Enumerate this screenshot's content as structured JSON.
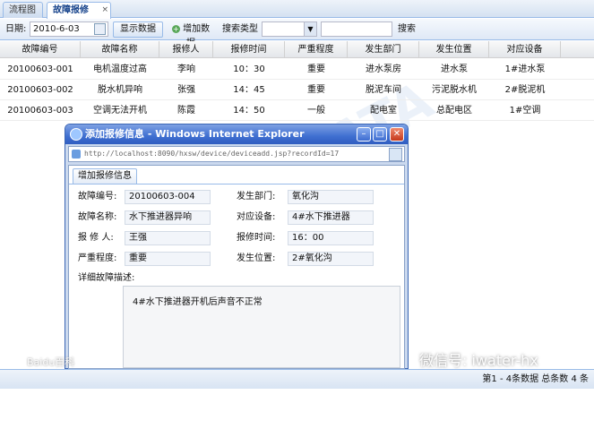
{
  "tabs": [
    {
      "label": "流程图"
    },
    {
      "label": "故障报修",
      "close": "×"
    }
  ],
  "toolbar": {
    "date_label": "日期:",
    "date_value": "2010-6-03",
    "show_button": "显示数据",
    "add_button": "增加数据",
    "search_type_label": "搜索类型",
    "search_type_value": "",
    "search_input_value": "",
    "search_button": "搜索"
  },
  "grid": {
    "headers": [
      "故障编号",
      "故障名称",
      "报修人",
      "报修时间",
      "严重程度",
      "发生部门",
      "发生位置",
      "对应设备"
    ],
    "rows": [
      [
        "20100603-001",
        "电机温度过高",
        "李响",
        "10：30",
        "重要",
        "进水泵房",
        "进水泵",
        "1#进水泵"
      ],
      [
        "20100603-002",
        "脱水机异响",
        "张强",
        "14：45",
        "重要",
        "脱泥车间",
        "污泥脱水机",
        "2#脱泥机"
      ],
      [
        "20100603-003",
        "空调无法开机",
        "陈霞",
        "14：50",
        "一般",
        "配电室",
        "总配电区",
        "1#空调"
      ]
    ]
  },
  "popup": {
    "title": "添加报修信息 - Windows Internet Explorer",
    "url": "http://localhost:8090/hxsw/device/deviceadd.jsp?recordId=17",
    "tab_label": "增加报修信息",
    "fields": {
      "fault_no_label": "故障编号:",
      "fault_no_value": "20100603-004",
      "fault_name_label": "故障名称:",
      "fault_name_value": "水下推进器异响",
      "reporter_label": "报 修 人:",
      "reporter_value": "王强",
      "severity_label": "严重程度:",
      "severity_value": "重要",
      "dept_label": "发生部门:",
      "dept_value": "氧化沟",
      "device_label": "对应设备:",
      "device_value": "4#水下推进器",
      "time_label": "报修时间:",
      "time_value": "16：00",
      "location_label": "发生位置:",
      "location_value": "2#氧化沟",
      "desc_label": "详细故障描述:",
      "desc_value": "4#水下推进器开机后声音不正常"
    }
  },
  "status": {
    "paging": "第1 - 4条数据  总条数 4 条"
  },
  "watermarks": {
    "baidu": "Baidu百科",
    "wechat": "微信号: iwater-hx"
  },
  "colors": {
    "accent": "#99bbe8",
    "title_blue": "#15428b",
    "popup_title": "#3f6fd1"
  }
}
